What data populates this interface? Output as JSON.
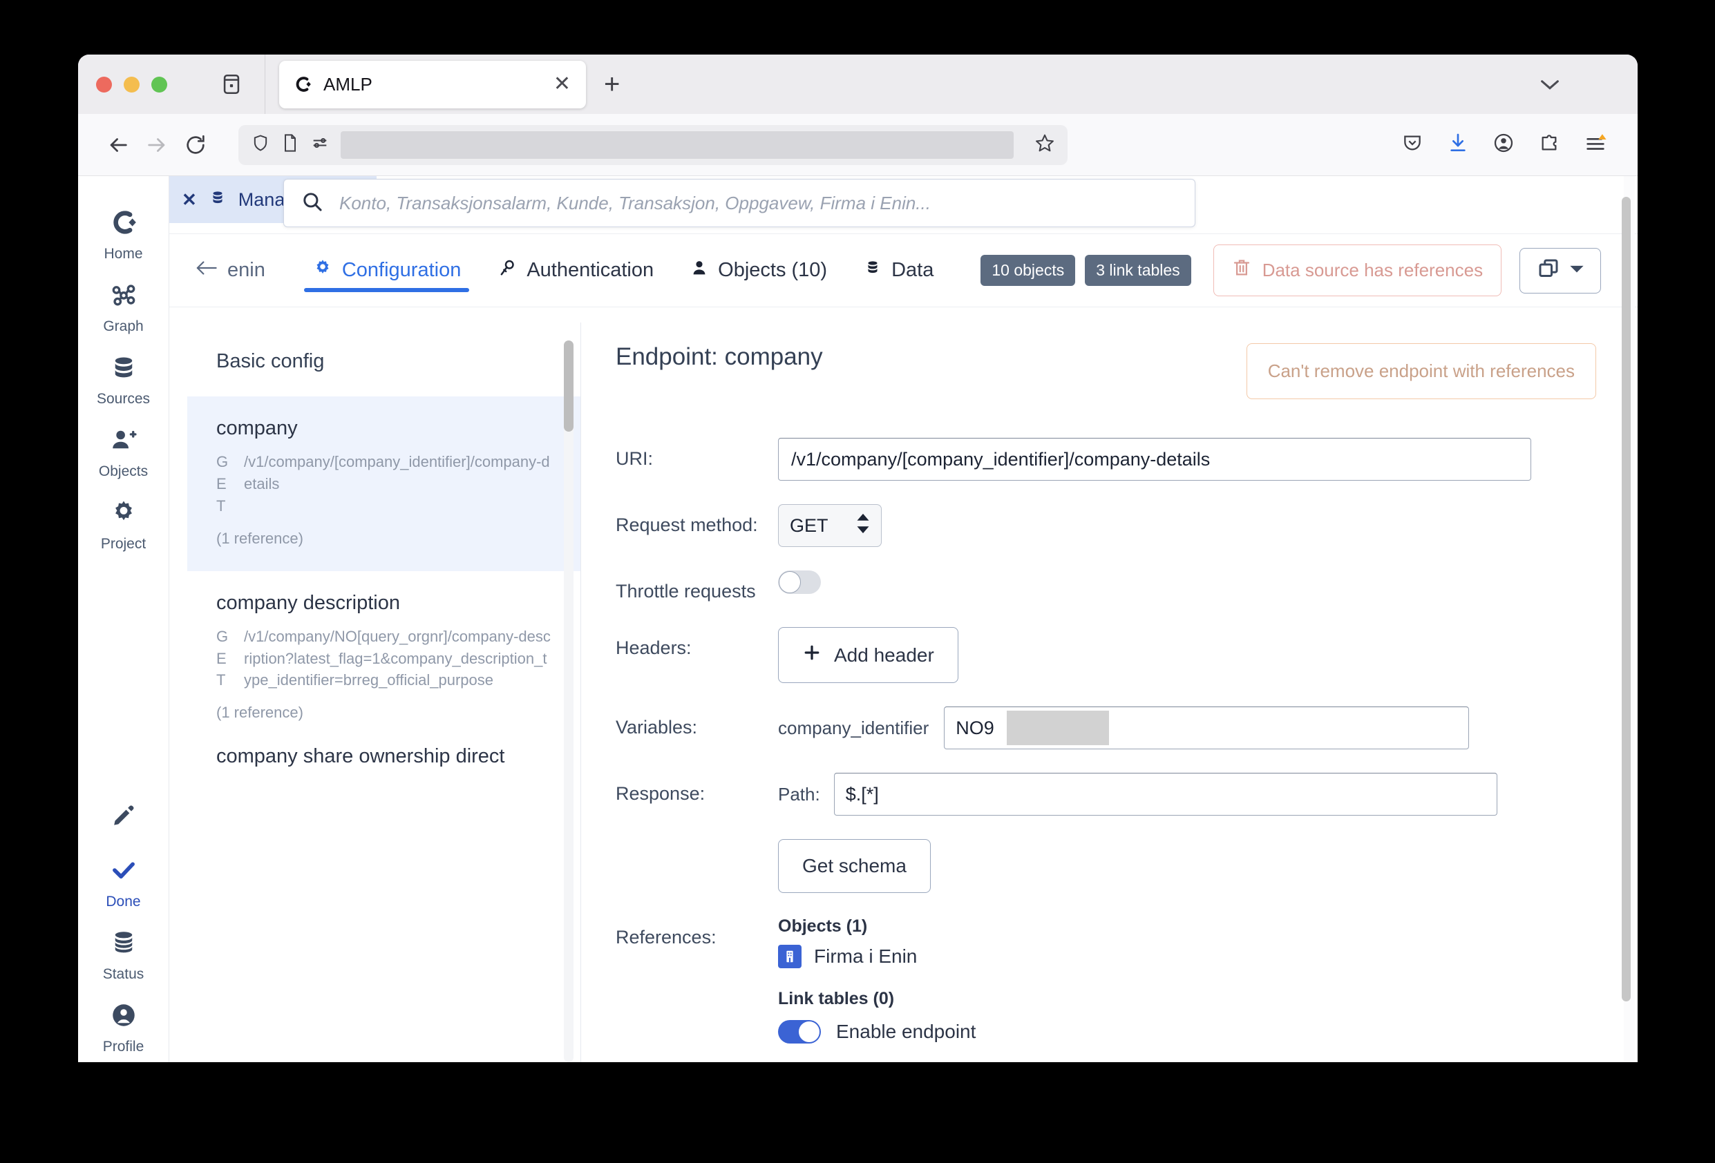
{
  "browser": {
    "tab": {
      "title": "AMLP",
      "favicon": "amlp-logo-icon",
      "close": "✕"
    },
    "new_tab": "+",
    "sidebar_toggle_icon": "sidebar-icon",
    "tablist_chevron_icon": "chevron-down-icon",
    "nav": {
      "back_icon": "back-arrow-icon",
      "forward_icon": "forward-arrow-icon",
      "reload_icon": "reload-icon",
      "shield_icon": "shield-icon",
      "page_icon": "page-icon",
      "permissions_icon": "permissions-icon",
      "url_value": "",
      "bookmark_icon": "star-icon",
      "pocket_icon": "pocket-icon",
      "download_icon": "download-icon",
      "account_icon": "account-icon",
      "extensions_icon": "extensions-icon",
      "menu_icon": "hamburger-menu-icon"
    }
  },
  "rail": {
    "top_items": [
      {
        "label": "Home",
        "icon": "amlp-logo-icon"
      },
      {
        "label": "Graph",
        "icon": "graph-icon"
      },
      {
        "label": "Sources",
        "icon": "database-icon"
      },
      {
        "label": "Objects",
        "icon": "person-add-icon"
      },
      {
        "label": "Project",
        "icon": "gear-icon"
      }
    ],
    "bottom_items": [
      {
        "label": "",
        "icon": "pencil-icon"
      },
      {
        "label": "Done",
        "icon": "check-icon"
      },
      {
        "label": "Status",
        "icon": "database-stack-icon"
      },
      {
        "label": "Profile",
        "icon": "profile-icon"
      }
    ]
  },
  "doc_tab": {
    "label": "Manage so",
    "close": "✕",
    "icon": "database-icon"
  },
  "search": {
    "icon": "search-icon",
    "placeholder": "Konto, Transaksjonsalarm, Kunde, Transaksjon, Oppgavew, Firma i Enin...",
    "value": ""
  },
  "toolbar": {
    "back_label": "enin",
    "back_icon": "arrow-left-icon",
    "tabs": [
      {
        "label": "Configuration",
        "icon": "gear-icon",
        "active": true
      },
      {
        "label": "Authentication",
        "icon": "key-icon",
        "active": false
      },
      {
        "label": "Objects (10)",
        "icon": "person-icon",
        "active": false
      },
      {
        "label": "Data",
        "icon": "database-icon",
        "active": false
      }
    ],
    "pills": [
      "10 objects",
      "3 link tables"
    ],
    "danger_label": "Data source has references",
    "danger_icon": "trash-icon",
    "copy_icon": "copy-icon",
    "copy_chevron_icon": "chevron-down-icon"
  },
  "endpoint_list": {
    "heading": "Basic config",
    "items": [
      {
        "name": "company",
        "method": "GET",
        "uri": "/v1/company/[company_identifier]/company-details",
        "references": "(1 reference)",
        "selected": true
      },
      {
        "name": "company description",
        "method": "GET",
        "uri": "/v1/company/NO[query_orgnr]/company-description?latest_flag=1&company_description_type_identifier=brreg_official_purpose",
        "references": "(1 reference)",
        "selected": false
      }
    ],
    "truncated_item": "company share ownership direct"
  },
  "detail": {
    "title": "Endpoint: company",
    "warning": "Can't remove endpoint with references",
    "uri_label": "URI:",
    "uri_value": "/v1/company/[company_identifier]/company-details",
    "method_label": "Request method:",
    "method_value": "GET",
    "method_stepper_icon": "stepper-updown-icon",
    "throttle_label": "Throttle requests",
    "throttle_on": false,
    "headers_label": "Headers:",
    "add_header_label": "Add header",
    "add_header_icon": "plus-icon",
    "variables_label": "Variables:",
    "variable_name": "company_identifier",
    "variable_value": "NO9",
    "response_label": "Response:",
    "path_label": "Path:",
    "path_value": "$.[*]",
    "get_schema_label": "Get schema",
    "references_label": "References:",
    "objects_heading": "Objects (1)",
    "object_item": "Firma i Enin",
    "object_item_icon": "building-icon",
    "link_tables_heading": "Link tables (0)",
    "enable_label": "Enable endpoint",
    "enable_on": true
  },
  "colors": {
    "accent": "#2f6fe4",
    "toggle_on": "#3b63d4",
    "pill_bg": "#5c6b80",
    "danger": "#d89a93",
    "warn_border": "#f3c9a8",
    "selected_row": "#eef3fd",
    "tab_bg": "#dde6f7"
  }
}
